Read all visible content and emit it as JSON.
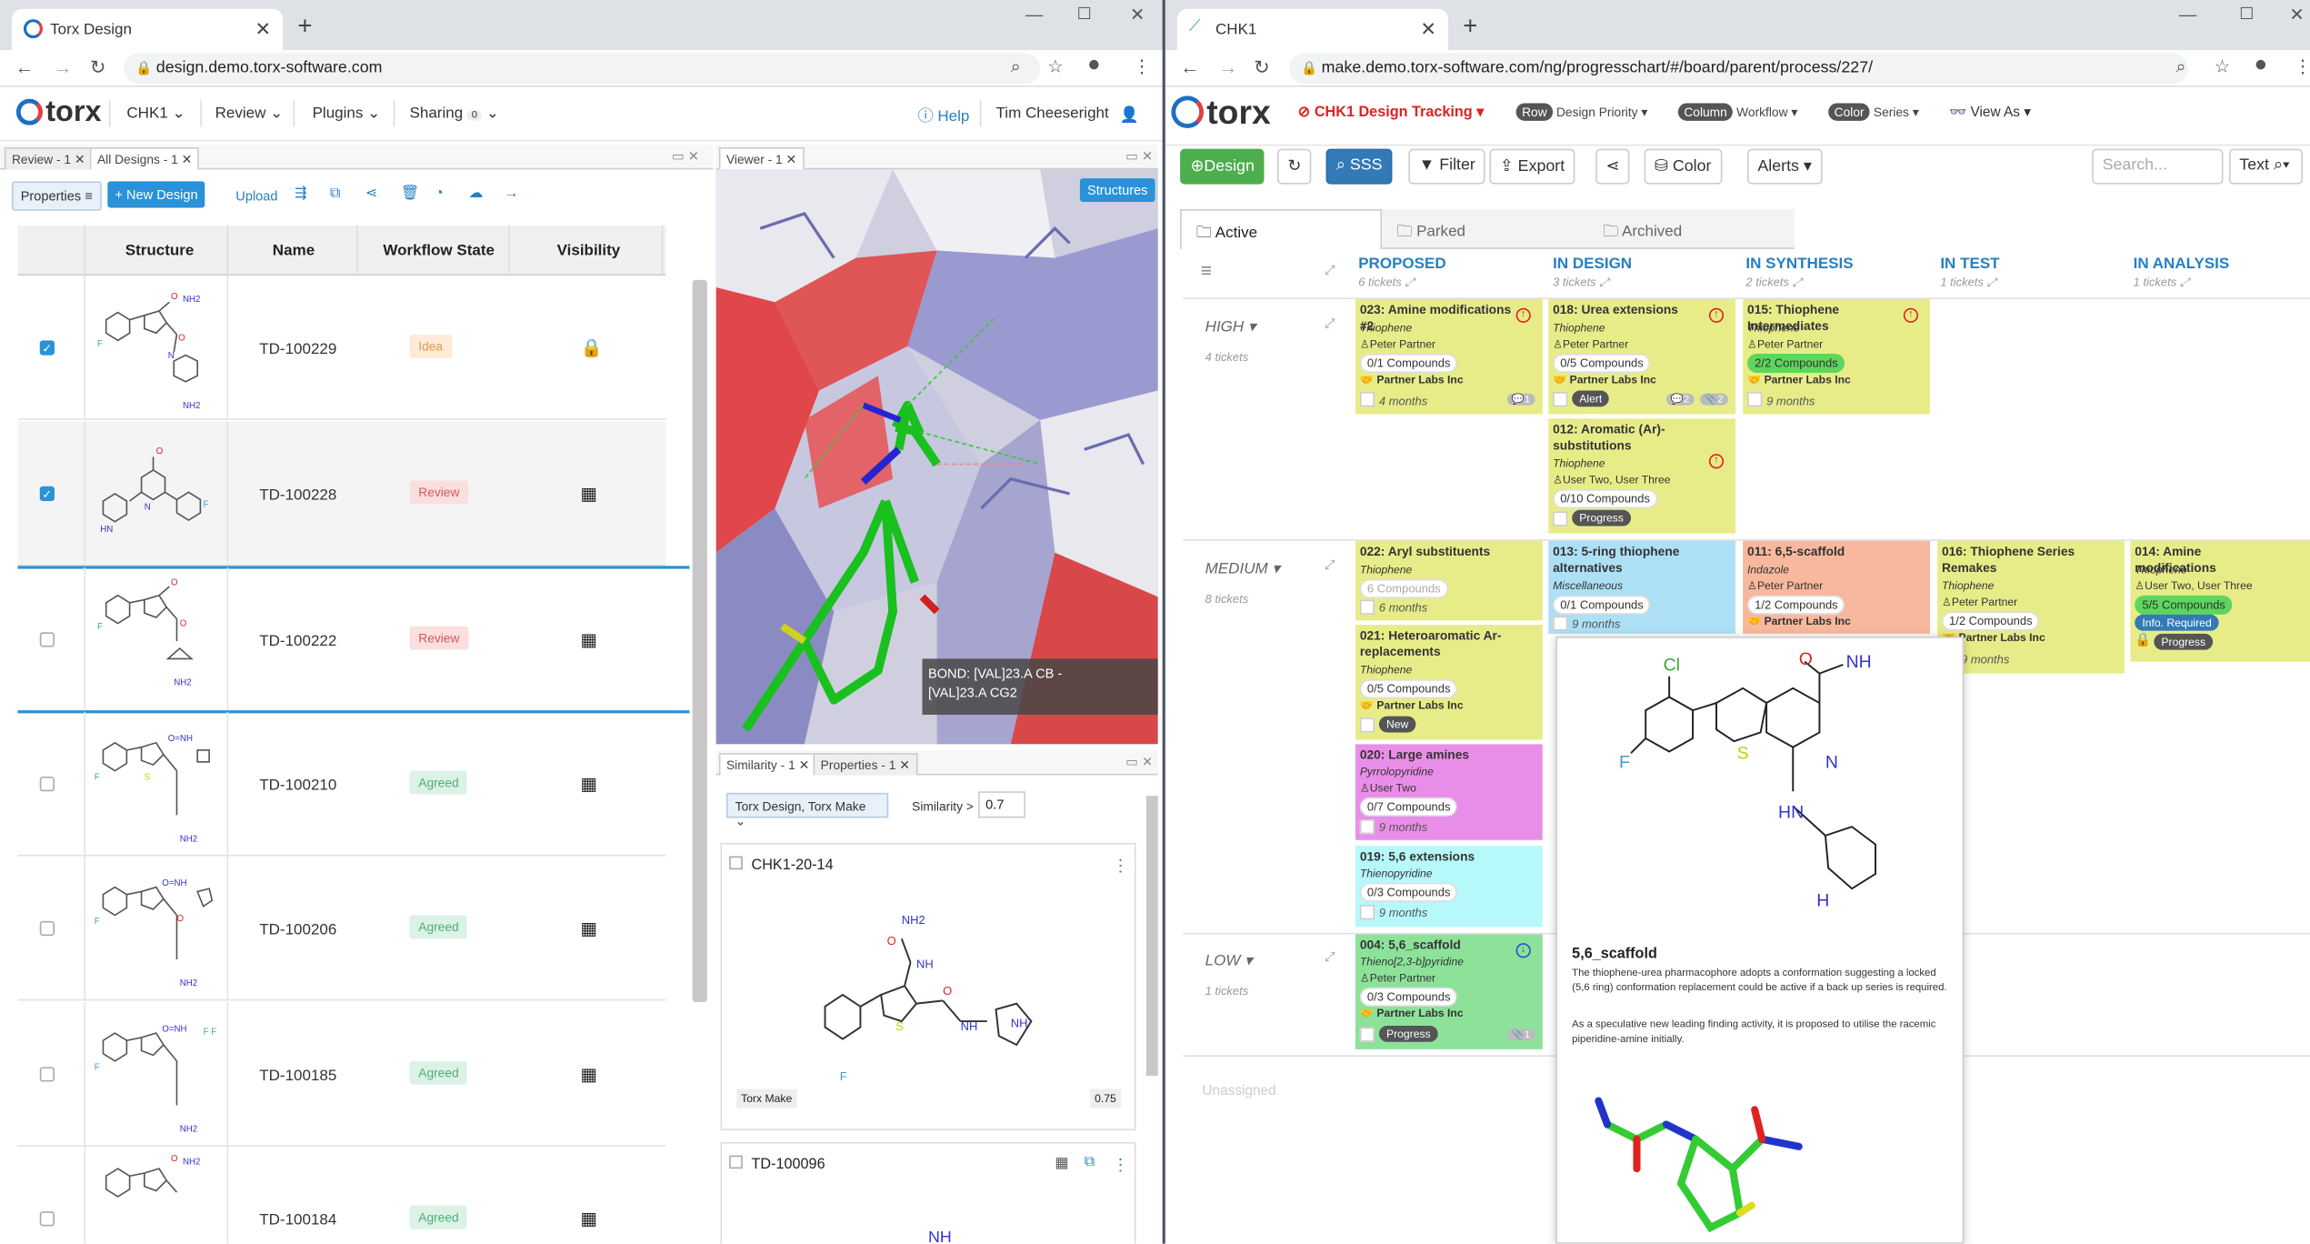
{
  "left_window": {
    "tab_title": "Torx Design",
    "url": "design.demo.torx-software.com",
    "app": {
      "logo": "torx",
      "menu": [
        "CHK1",
        "Review",
        "Plugins",
        "Sharing"
      ],
      "sharing_count": "0",
      "help": "Help",
      "user": "Tim Cheeseright"
    },
    "panel_tabs": [
      "Review - 1",
      "All Designs - 1"
    ],
    "toolbar": {
      "properties": "Properties",
      "new_design": "+ New Design",
      "upload": "Upload"
    },
    "columns": [
      "Structure",
      "Name",
      "Workflow State",
      "Visibility"
    ],
    "rows": [
      {
        "name": "TD-100229",
        "state": "Idea",
        "checked": true
      },
      {
        "name": "TD-100228",
        "state": "Review",
        "checked": true
      },
      {
        "name": "TD-100222",
        "state": "Review",
        "checked": false
      },
      {
        "name": "TD-100210",
        "state": "Agreed",
        "checked": false
      },
      {
        "name": "TD-100206",
        "state": "Agreed",
        "checked": false
      },
      {
        "name": "TD-100185",
        "state": "Agreed",
        "checked": false
      },
      {
        "name": "TD-100184",
        "state": "Agreed",
        "checked": false
      }
    ],
    "viewer": {
      "tab": "Viewer - 1",
      "structures_button": "Structures",
      "tooltip": "BOND: [VAL]23.A CB -\n[VAL]23.A CG2"
    },
    "similarity": {
      "tabs": [
        "Similarity - 1",
        "Properties - 1"
      ],
      "source": "Torx Design, Torx Make",
      "label": "Similarity >",
      "value": "0.7",
      "results": [
        {
          "id": "CHK1-20-14",
          "source": "Torx Make",
          "score": "0.75"
        },
        {
          "id": "TD-100096"
        }
      ]
    }
  },
  "right_window": {
    "tab_title": "CHK1",
    "url": "make.demo.torx-software.com/ng/progresschart/#/board/parent/process/227/",
    "app": {
      "logo": "torx",
      "tracking": "CHK1 Design Tracking",
      "row_chip": "Row",
      "row_value": "Design Priority",
      "column_chip": "Column",
      "column_value": "Workflow",
      "color_chip": "Color",
      "color_value": "Series",
      "view_as": "View As"
    },
    "toolbar": {
      "design": "Design",
      "sss": "SSS",
      "filter": "Filter",
      "export": "Export",
      "color": "Color",
      "alerts": "Alerts",
      "search_placeholder": "Search...",
      "text": "Text"
    },
    "status_tabs": [
      "Active",
      "Parked",
      "Archived"
    ],
    "columns": [
      {
        "title": "PROPOSED",
        "count": "6 tickets"
      },
      {
        "title": "IN DESIGN",
        "count": "3 tickets"
      },
      {
        "title": "IN SYNTHESIS",
        "count": "2 tickets"
      },
      {
        "title": "IN TEST",
        "count": "1 tickets"
      },
      {
        "title": "IN ANALYSIS",
        "count": "1 tickets"
      }
    ],
    "lanes": [
      {
        "title": "HIGH",
        "count": "4 tickets"
      },
      {
        "title": "MEDIUM",
        "count": "8 tickets"
      },
      {
        "title": "LOW",
        "count": "1 tickets"
      },
      {
        "title": "Unassigned"
      }
    ],
    "cards": {
      "c023": {
        "title": "023: Amine modifications #2",
        "series": "Thiophene",
        "user": "Peter Partner",
        "compounds": "0/1 Compounds",
        "org": "Partner Labs Inc",
        "age": "4 months",
        "count": "1"
      },
      "c018": {
        "title": "018: Urea extensions",
        "series": "Thiophene",
        "user": "Peter Partner",
        "compounds": "0/5 Compounds",
        "org": "Partner Labs Inc",
        "tag": "Alert",
        "c1": "2",
        "c2": "2"
      },
      "c015": {
        "title": "015: Thiophene Intermediates",
        "series": "Thiophene",
        "user": "Peter Partner",
        "compounds": "2/2 Compounds",
        "org": "Partner Labs Inc",
        "age": "9 months"
      },
      "c012": {
        "title": "012: Aromatic (Ar)-substitutions",
        "series": "Thiophene",
        "user": "User Two, User Three",
        "compounds": "0/10 Compounds",
        "tag": "Progress"
      },
      "c022": {
        "title": "022: Aryl substituents",
        "series": "Thiophene",
        "compounds": "6 Compounds",
        "age": "6 months"
      },
      "c013": {
        "title": "013: 5-ring thiophene alternatives",
        "series": "Miscellaneous",
        "compounds": "0/1 Compounds",
        "age": "9 months"
      },
      "c011": {
        "title": "011: 6,5-scaffold",
        "series": "Indazole",
        "user": "Peter Partner",
        "compounds": "1/2 Compounds",
        "org": "Partner Labs Inc"
      },
      "c016": {
        "title": "016: Thiophene Series Remakes",
        "series": "Thiophene",
        "user": "Peter Partner",
        "compounds": "1/2 Compounds",
        "org": "Partner Labs Inc",
        "age": "9 months"
      },
      "c014": {
        "title": "014: Amine modifications",
        "series": "Thiophene",
        "user": "User Two, User Three",
        "compounds": "5/5 Compounds",
        "tag1": "Info. Required",
        "tag2": "Progress"
      },
      "c021": {
        "title": "021: Heteroaromatic Ar-replacements",
        "series": "Thiophene",
        "compounds": "0/5 Compounds",
        "org": "Partner Labs Inc",
        "tag": "New"
      },
      "c020": {
        "title": "020: Large amines",
        "series": "Pyrrolopyridine",
        "user": "User Two",
        "compounds": "0/7 Compounds",
        "age": "9 months"
      },
      "c019": {
        "title": "019: 5,6 extensions",
        "series": "Thienopyridine",
        "compounds": "0/3 Compounds",
        "age": "9 months"
      },
      "c004": {
        "title": "004: 5,6_scaffold",
        "series": "Thieno[2,3-b]pyridine",
        "user": "Peter Partner",
        "compounds": "0/3 Compounds",
        "org": "Partner Labs Inc",
        "tag": "Progress",
        "count": "1"
      }
    },
    "popup": {
      "title": "5,6_scaffold",
      "p1": "The thiophene-urea pharmacophore adopts a conformation suggesting a locked (5,6 ring) conformation replacement could be active if a back up series is required.",
      "p2": "As a speculative new leading finding activity, it is proposed to utilise the racemic piperidine-amine initially.",
      "atoms": {
        "cl": "Cl",
        "f": "F",
        "o": "O",
        "nh2": "NH",
        "s": "S",
        "n": "N",
        "hn": "HN",
        "h2n": "H",
        "n2": "N"
      }
    }
  }
}
